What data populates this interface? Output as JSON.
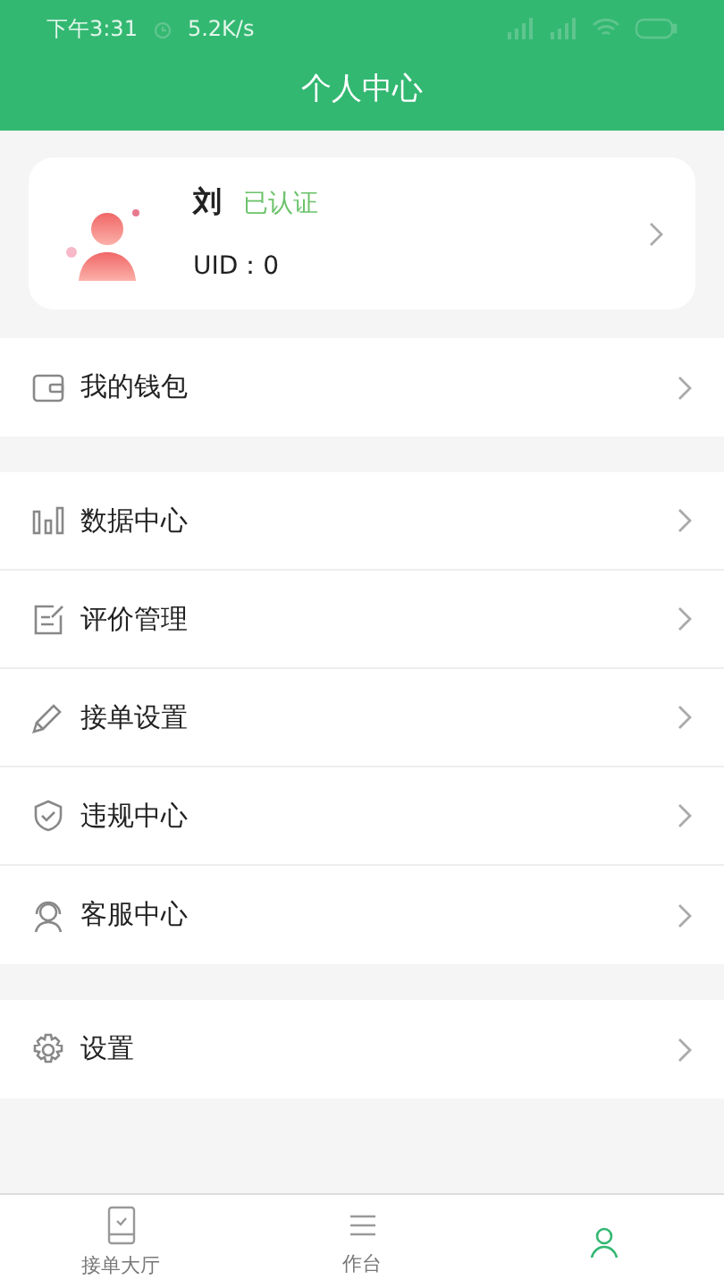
{
  "status_bar": {
    "time": "下午3:31",
    "speed": "5.2K/s"
  },
  "title": "个人中心",
  "profile": {
    "name": "刘",
    "badge": "已认证",
    "uid": "UID：0"
  },
  "groups": [
    {
      "items": [
        {
          "label": "我的钱包"
        }
      ]
    },
    {
      "items": [
        {
          "label": "数据中心"
        },
        {
          "label": "评价管理"
        },
        {
          "label": "接单设置"
        },
        {
          "label": "违规中心"
        },
        {
          "label": "客服中心"
        }
      ]
    },
    {
      "items": [
        {
          "label": "设置"
        }
      ]
    }
  ],
  "tabs": [
    {
      "label": "接单大厅",
      "selected": false
    },
    {
      "label": "作台",
      "selected": false
    },
    {
      "selected": true
    }
  ]
}
